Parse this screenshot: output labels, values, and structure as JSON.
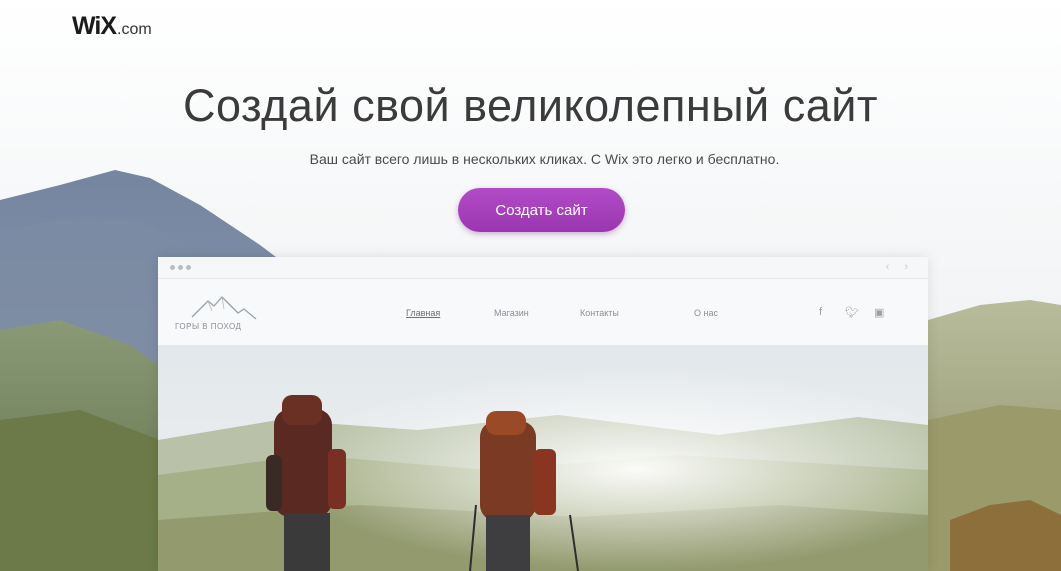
{
  "logo": {
    "mark": "WiX",
    "suffix": ".com"
  },
  "hero": {
    "headline": "Создай свой великолепный сайт",
    "subtitle": "Ваш сайт всего лишь в нескольких кликах. С Wix это легко и бесплатно.",
    "cta_label": "Создать сайт"
  },
  "browser_mock": {
    "site_logo_text": "ГОРЫ В ПОХОД",
    "nav": [
      "Главная",
      "Магазин",
      "Контакты",
      "О нас"
    ],
    "active_nav": "Главная",
    "social_icons": [
      "facebook-icon",
      "twitter-icon",
      "instagram-icon"
    ]
  },
  "colors": {
    "cta": "#a83fbe",
    "headline": "#3b3b3b",
    "sky": "#f3f5f6",
    "mountain": "#7d8fa8"
  }
}
